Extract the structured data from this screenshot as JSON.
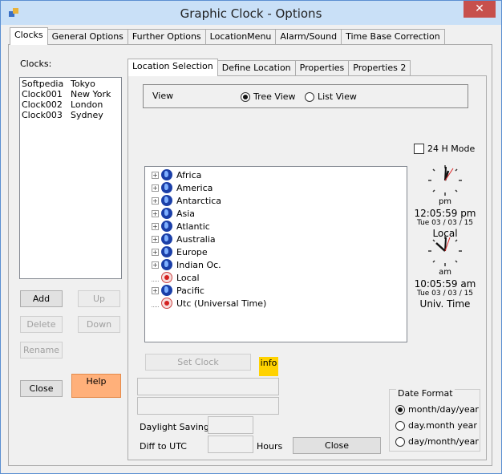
{
  "window": {
    "title": "Graphic Clock - Options",
    "close_glyph": "✕",
    "icon": "app-icon"
  },
  "main_tabs": [
    "Clocks",
    "General Options",
    "Further Options",
    "LocationMenu",
    "Alarm/Sound",
    "Time Base Correction"
  ],
  "clocks_label": "Clocks:",
  "clocks": [
    {
      "name": "Softpedia",
      "city": "Tokyo"
    },
    {
      "name": "Clock001",
      "city": "New York"
    },
    {
      "name": "Clock002",
      "city": "London"
    },
    {
      "name": "Clock003",
      "city": "Sydney"
    }
  ],
  "left_buttons": {
    "add": "Add",
    "up": "Up",
    "delete": "Delete",
    "down": "Down",
    "rename": "Rename",
    "close": "Close",
    "help": "Help"
  },
  "inner_tabs": [
    "Location Selection",
    "Define Location",
    "Properties",
    "Properties 2"
  ],
  "view": {
    "label": "View",
    "tree": "Tree View",
    "list": "List View",
    "selected": "tree"
  },
  "mode24": "24 H Mode",
  "tree_items": [
    {
      "label": "Africa",
      "kind": "globe"
    },
    {
      "label": "America",
      "kind": "globe"
    },
    {
      "label": "Antarctica",
      "kind": "globe"
    },
    {
      "label": "Asia",
      "kind": "globe"
    },
    {
      "label": "Atlantic",
      "kind": "globe"
    },
    {
      "label": "Australia",
      "kind": "globe"
    },
    {
      "label": "Europe",
      "kind": "globe"
    },
    {
      "label": "Indian Oc.",
      "kind": "globe"
    },
    {
      "label": "Local",
      "kind": "pin"
    },
    {
      "label": "Pacific",
      "kind": "globe"
    },
    {
      "label": "Utc (Universal Time)",
      "kind": "pin"
    }
  ],
  "clock_local": {
    "ampm": "pm",
    "time": "12:05:59 pm",
    "date": "Tue 03 / 03 / 15",
    "label": "Local"
  },
  "clock_utc": {
    "ampm": "am",
    "time": "10:05:59 am",
    "date": "Tue 03 / 03 / 15",
    "label": "Univ. Time"
  },
  "set_clock": "Set Clock",
  "info": "info",
  "daylight_label": "Daylight Saving:",
  "diff_label": "Diff to UTC",
  "hours_label": "Hours",
  "close_inner": "Close",
  "date_format": {
    "title": "Date Format",
    "options": [
      "month/day/year",
      "day.month year",
      "day/month/year"
    ],
    "selected": 0
  },
  "colors": {
    "help_bg": "#ffb07a",
    "info_bg": "#ffd200",
    "titlebar": "#c9e0f7",
    "close_red": "#c7504c"
  }
}
